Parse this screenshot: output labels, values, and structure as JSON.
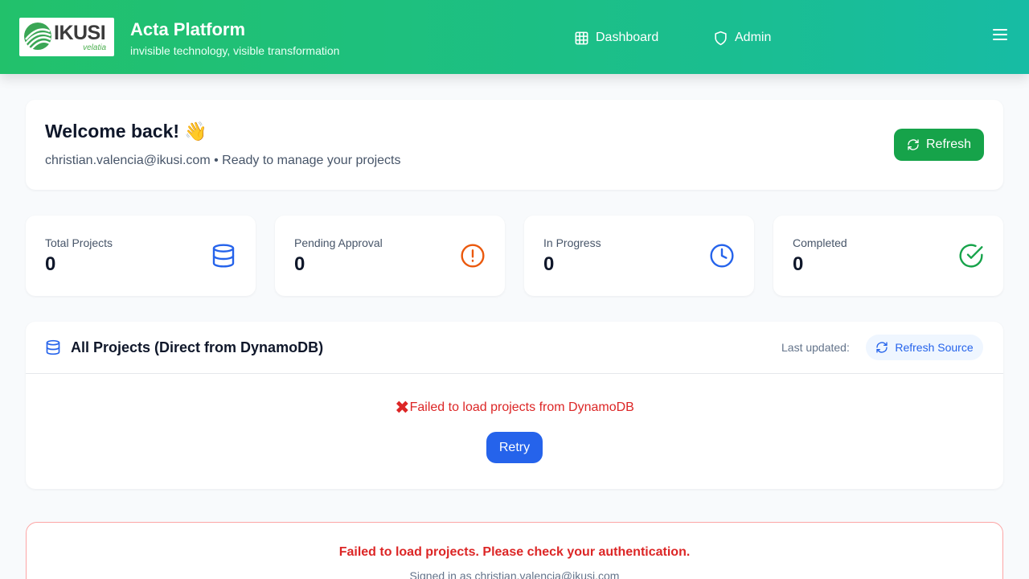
{
  "header": {
    "logo": {
      "word": "IKUSI",
      "sub": "velatia"
    },
    "title": "Acta Platform",
    "tagline": "invisible technology, visible transformation",
    "nav": [
      {
        "label": "Dashboard",
        "icon": "grid-icon"
      },
      {
        "label": "Admin",
        "icon": "shield-icon"
      }
    ],
    "menu_icon": "hamburger-icon"
  },
  "welcome": {
    "title": "Welcome back! 👋",
    "subtitle": "christian.valencia@ikusi.com • Ready to manage your projects",
    "refresh_label": "Refresh"
  },
  "stats": [
    {
      "label": "Total Projects",
      "value": "0",
      "icon": "database-icon",
      "color": "#2563eb"
    },
    {
      "label": "Pending Approval",
      "value": "0",
      "icon": "alert-circle-icon",
      "color": "#ea580c"
    },
    {
      "label": "In Progress",
      "value": "0",
      "icon": "clock-icon",
      "color": "#2563eb"
    },
    {
      "label": "Completed",
      "value": "0",
      "icon": "check-circle-icon",
      "color": "#16a34a"
    }
  ],
  "projects": {
    "title": "All Projects (Direct from DynamoDB)",
    "last_updated_label": "Last updated:",
    "refresh_source_label": "Refresh Source",
    "error_message": "Failed to load projects from DynamoDB",
    "retry_label": "Retry"
  },
  "auth_error": {
    "title": "Failed to load projects. Please check your authentication.",
    "subtitle": "Signed in as christian.valencia@ikusi.com"
  },
  "colors": {
    "header_gradient_start": "#22c16b",
    "header_gradient_end": "#17bca4",
    "primary_green": "#16a34a",
    "primary_blue": "#2563eb",
    "error_red": "#dc2626"
  }
}
